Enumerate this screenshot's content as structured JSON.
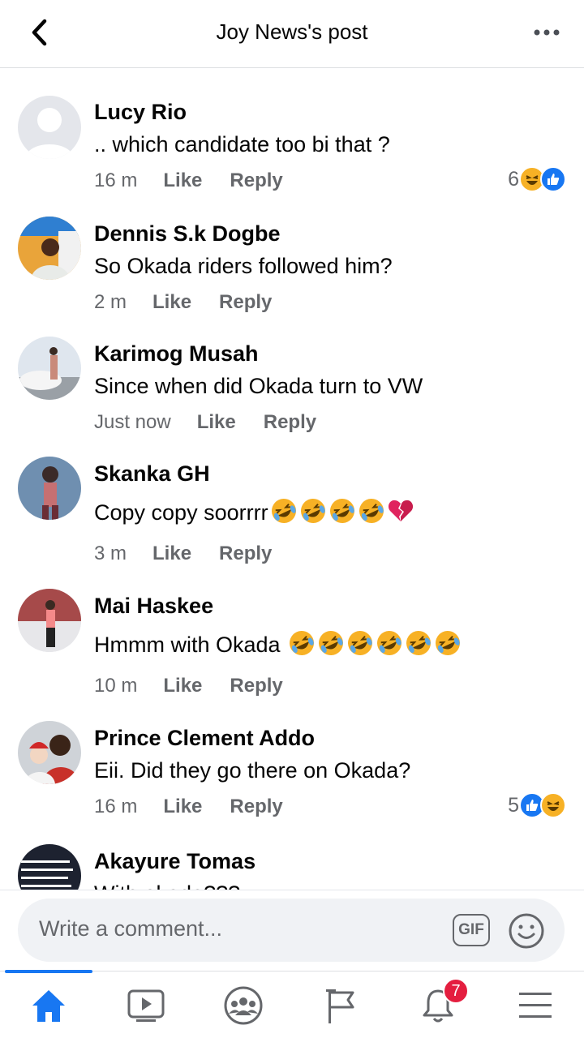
{
  "header": {
    "title": "Joy News's post"
  },
  "comments": [
    {
      "name": "Lucy Rio",
      "text": ".. which candidate too bi that ?",
      "time": "16 m",
      "like": "Like",
      "reply": "Reply",
      "reaction_count": "6",
      "reactions": [
        "haha",
        "like"
      ]
    },
    {
      "name": "Dennis S.k Dogbe",
      "text": "So Okada riders followed him?",
      "time": "2 m",
      "like": "Like",
      "reply": "Reply"
    },
    {
      "name": "Karimog Musah",
      "text": "Since when did Okada turn to VW",
      "time": "Just now",
      "like": "Like",
      "reply": "Reply"
    },
    {
      "name": "Skanka GH",
      "text": "Copy copy soorrrr",
      "emojis": [
        "rofl",
        "rofl",
        "rofl",
        "rofl",
        "broken-heart"
      ],
      "time": "3 m",
      "like": "Like",
      "reply": "Reply"
    },
    {
      "name": "Mai Haskee",
      "text": "Hmmm with Okada ",
      "emojis": [
        "rofl",
        "rofl",
        "rofl",
        "rofl",
        "rofl",
        "rofl"
      ],
      "time": "10 m",
      "like": "Like",
      "reply": "Reply"
    },
    {
      "name": "Prince Clement Addo",
      "text": "Eii. Did they go there on Okada?",
      "time": "16 m",
      "like": "Like",
      "reply": "Reply",
      "reaction_count": "5",
      "reactions": [
        "like",
        "haha"
      ]
    },
    {
      "name": "Akayure Tomas",
      "text": "With okada???"
    }
  ],
  "composer": {
    "placeholder": "Write a comment...",
    "gif_label": "GIF"
  },
  "nav": {
    "items": [
      "home-icon",
      "watch-icon",
      "groups-icon",
      "pages-icon",
      "notifications-icon",
      "menu-icon"
    ],
    "notification_badge": "7"
  },
  "colors": {
    "accent": "#1877f2",
    "meta": "#65676b",
    "badge": "#e41e3f",
    "haha": "#f7b125"
  }
}
